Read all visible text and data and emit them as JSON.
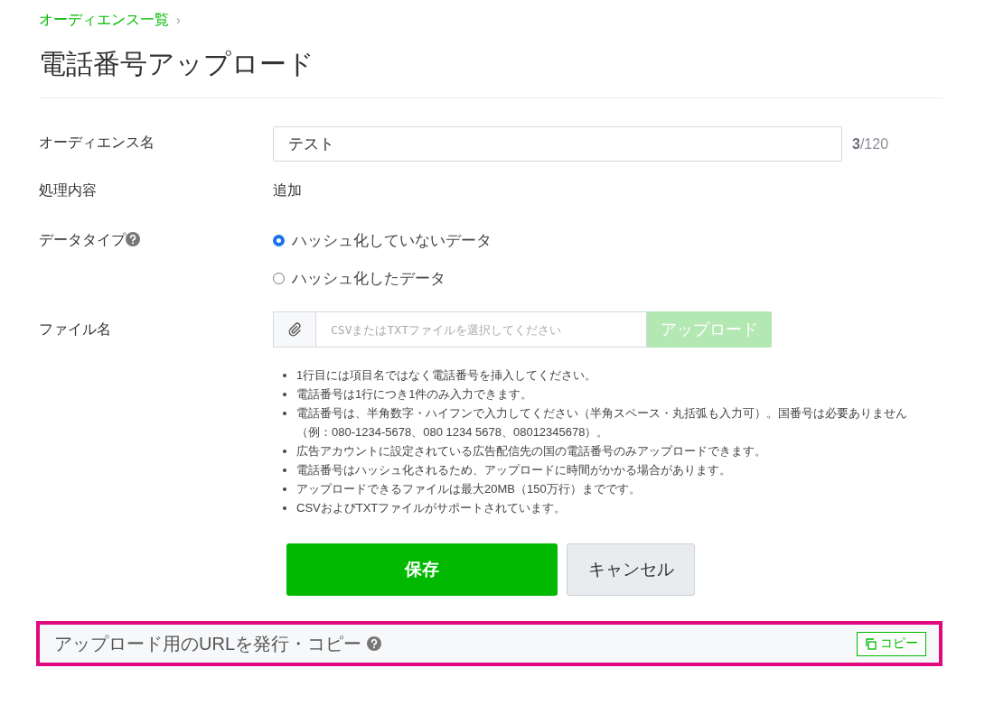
{
  "breadcrumb": {
    "label": "オーディエンス一覧",
    "separator": "›"
  },
  "title": "電話番号アップロード",
  "form": {
    "audience_name": {
      "label": "オーディエンス名",
      "value": "テスト",
      "counter": "**3**/120"
    },
    "process": {
      "label": "処理内容",
      "value": "追加"
    },
    "data_type": {
      "label": "データタイプ",
      "options": [
        {
          "label": "ハッシュ化していないデータ",
          "selected": true
        },
        {
          "label": "ハッシュ化したデータ",
          "selected": false
        }
      ]
    },
    "file": {
      "label": "ファイル名",
      "placeholder": "CSVまたはTXTファイルを選択してください",
      "upload_button": {
        "label": "アップロード",
        "disabled": true
      }
    },
    "notes": [
      "1行目には項目名ではなく電話番号を挿入してください。",
      "電話番号は1行につき1件のみ入力できます。",
      "電話番号は、半角数字・ハイフンで入力してください（半角スペース・丸括弧も入力可）。国番号は必要ありません（例：080-1234-5678、080 1234 5678、08012345678）。",
      "広告アカウントに設定されている広告配信先の国の電話番号のみアップロードできます。",
      "電話番号はハッシュ化されるため、アップロードに時間がかかる場合があります。",
      "アップロードできるファイルは最大20MB（150万行）までです。",
      "CSVおよびTXTファイルがサポートされています。"
    ]
  },
  "buttons": [
    {
      "label": "保存",
      "kind": "primary"
    },
    {
      "label": "キャンセル",
      "kind": "secondary"
    }
  ],
  "url_section": {
    "title": "アップロード用のURLを発行・コピー",
    "highlighted": true,
    "copy_button": "コピー"
  }
}
